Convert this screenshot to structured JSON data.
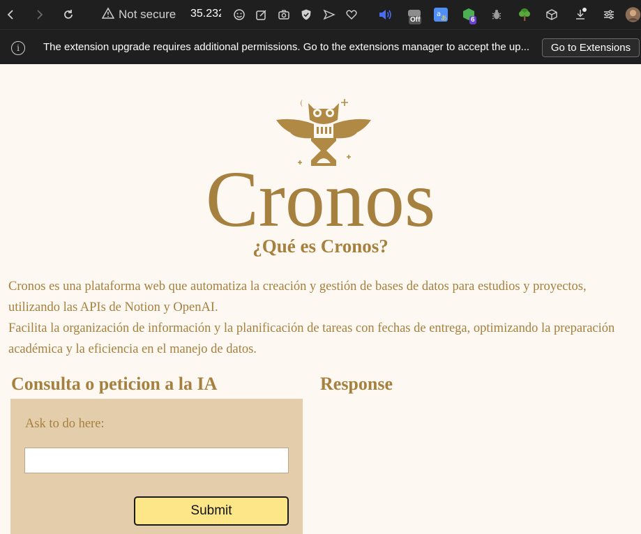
{
  "browser": {
    "security_label": "Not secure",
    "url_fragment": "35.232",
    "extension_badges": {
      "off_badge": "Off",
      "count_badge": "6"
    },
    "icons": [
      "back-icon",
      "forward-icon",
      "reload-icon",
      "warning-icon",
      "emoji-icon",
      "edit-icon",
      "camera-icon",
      "shield-icon",
      "send-icon",
      "heart-icon",
      "speaker-icon",
      "extension-off-icon",
      "translate-icon",
      "extension-count-icon",
      "bug-icon",
      "tree-icon",
      "cube-icon",
      "download-icon",
      "sliders-icon",
      "profile-avatar"
    ]
  },
  "infobar": {
    "message": "The extension upgrade requires additional permissions. Go to the extensions manager to accept the up...",
    "button_label": "Go to Extensions"
  },
  "page": {
    "brand": "Cronos",
    "subtitle": "¿Qué es Cronos?",
    "description_1": "Cronos es una plataforma web que automatiza la creación y gestión de bases de datos para estudios y proyectos, utilizando las APIs de Notion y OpenAI.",
    "description_2": "Facilita la organización de información y la planificación de tareas con fechas de entrega, optimizando la preparación académica y la eficiencia en el manejo de datos.",
    "query_heading": "Consulta o peticion a la IA",
    "response_heading": "Response",
    "ask_label": "Ask to do here:",
    "ask_value": "",
    "submit_label": "Submit"
  },
  "colors": {
    "brand_gold": "#a6803f",
    "page_bg": "#fdf8f1",
    "panel_bg": "#e4cdaa",
    "submit_bg": "#fde688",
    "browser_bg": "#1f1f1f"
  }
}
